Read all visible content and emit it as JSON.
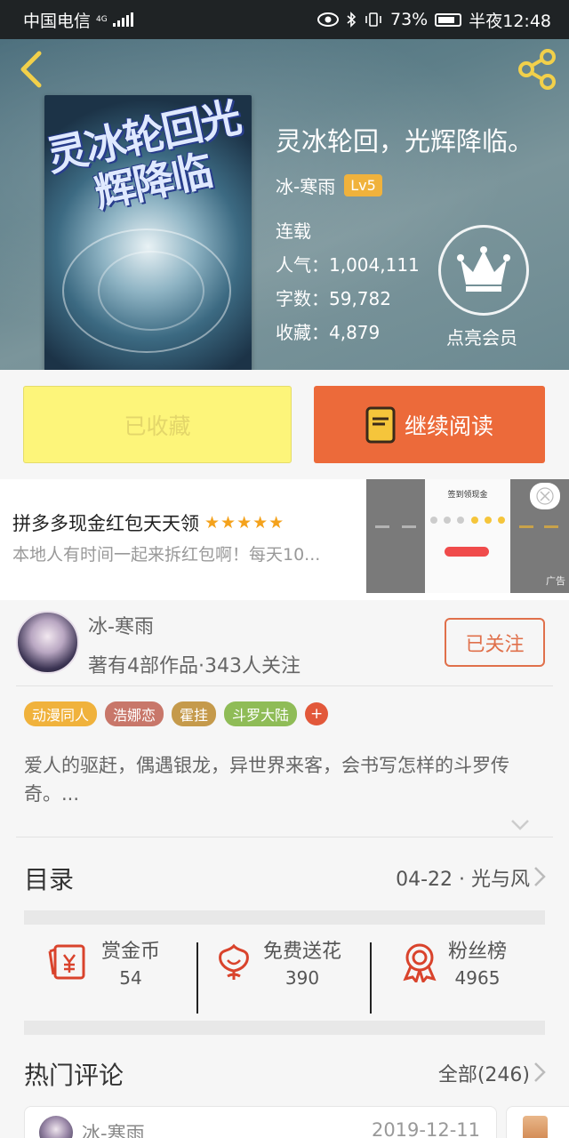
{
  "status_bar": {
    "carrier": "中国电信",
    "network": "4G",
    "battery": "73%",
    "time": "半夜12:48"
  },
  "book": {
    "title": "灵冰轮回，光辉降临。",
    "cover_title": "灵冰轮回光辉降临",
    "author": "冰-寒雨",
    "level": "Lv5",
    "status": "连载",
    "popularity": "人气：1,004,111",
    "word_count": "字数：59,782",
    "favorites": "收藏：4,879",
    "vip_label": "点亮会员"
  },
  "actions": {
    "favorited_label": "已收藏",
    "continue_label": "继续阅读"
  },
  "ad": {
    "title": "拼多多现金红包天天领",
    "stars": "★★★★★",
    "subtitle": "本地人有时间一起来拆红包啊！每天10...",
    "image_title": "签到领现金",
    "tag": "广告"
  },
  "author_card": {
    "name": "冰-寒雨",
    "stats": "著有4部作品·343人关注",
    "follow_label": "已关注",
    "tags": [
      {
        "label": "动漫同人",
        "color": "#f0b23c"
      },
      {
        "label": "浩娜恋",
        "color": "#c8776a"
      },
      {
        "label": "霍挂",
        "color": "#c59a4b"
      },
      {
        "label": "斗罗大陆",
        "color": "#8fbc57"
      }
    ],
    "tag_more": "+",
    "description": "爱人的驱赶，偶遇银龙，异世界来客，会书写怎样的斗罗传奇。..."
  },
  "toc": {
    "title": "目录",
    "latest": "04-22 · 光与风"
  },
  "stats": [
    {
      "label": "赏金币",
      "value": "54",
      "icon": "reward-coin-icon"
    },
    {
      "label": "免费送花",
      "value": "390",
      "icon": "flower-icon"
    },
    {
      "label": "粉丝榜",
      "value": "4965",
      "icon": "medal-icon"
    }
  ],
  "comments": {
    "title": "热门评论",
    "all_label": "全部(246)",
    "first": {
      "name": "冰-寒雨",
      "date": "2019-12-11"
    }
  },
  "colors": {
    "accent": "#ec6a3a",
    "fav_bg": "#fdf57a",
    "icon_red": "#d9432c"
  }
}
